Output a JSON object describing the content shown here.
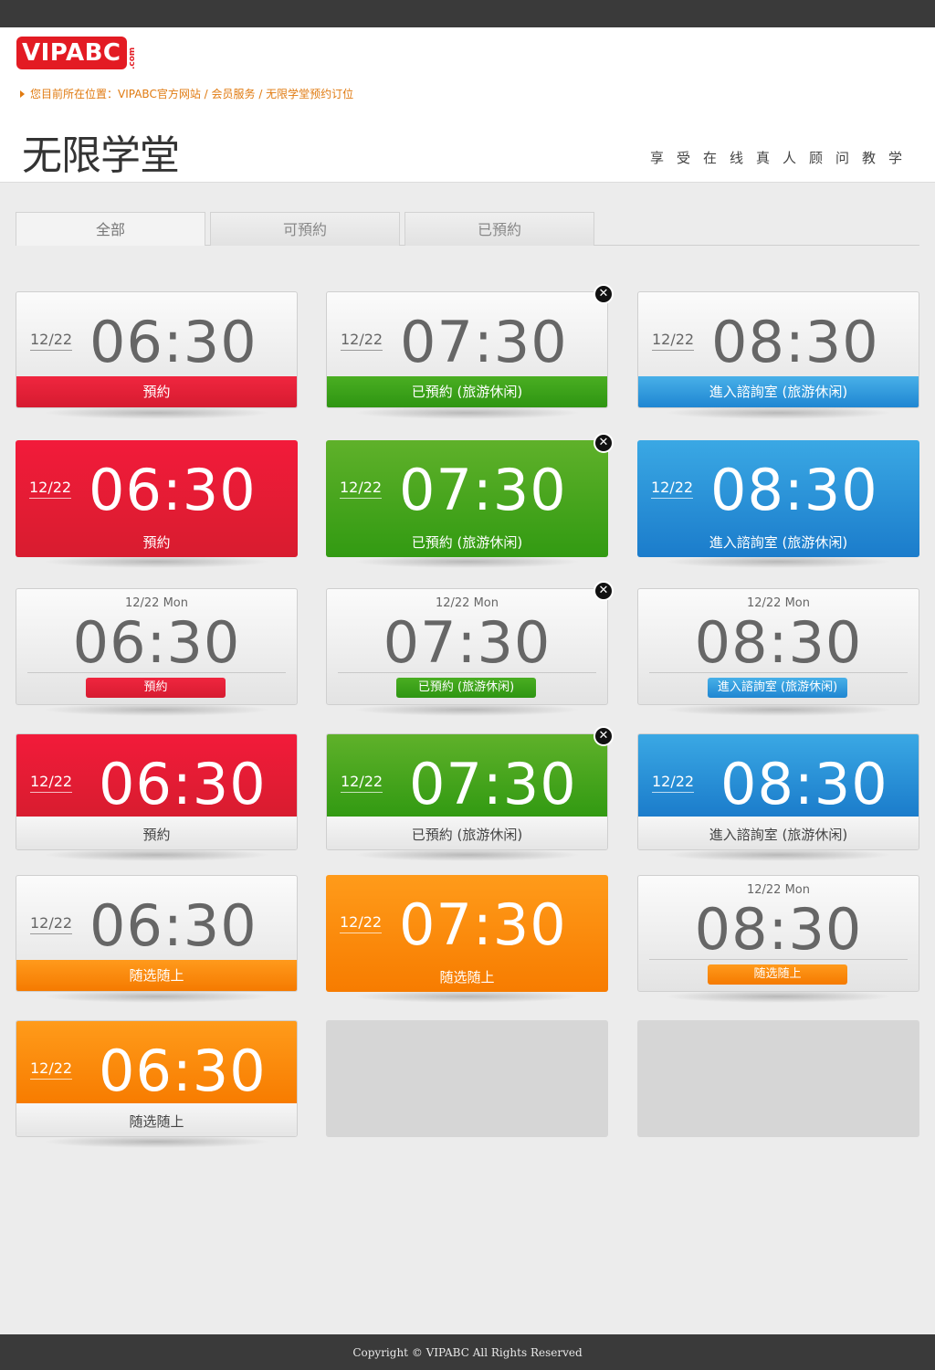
{
  "brand": {
    "logo_text": "VIPABC",
    "logo_suffix": ".com",
    "color": "#e31b23"
  },
  "breadcrumb": "您目前所在位置：VIPABC官方网站 / 会员服务 / 无限学堂预约订位",
  "page_title": "无限学堂",
  "slogan": "享受在线真人顾问教学",
  "tabs": [
    {
      "label": "全部",
      "active": true
    },
    {
      "label": "可預約",
      "active": false
    },
    {
      "label": "已預約",
      "active": false
    }
  ],
  "rows": [
    {
      "style": "strip",
      "cards": [
        {
          "date": "12/22",
          "time": "06:30",
          "label": "預約",
          "color": "red",
          "closable": false
        },
        {
          "date": "12/22",
          "time": "07:30",
          "label": "已預約 (旅游休闲)",
          "color": "green",
          "closable": true
        },
        {
          "date": "12/22",
          "time": "08:30",
          "label": "進入諮詢室 (旅游休闲)",
          "color": "blue",
          "closable": false
        }
      ]
    },
    {
      "style": "full",
      "cards": [
        {
          "date": "12/22",
          "time": "06:30",
          "label": "預約",
          "color": "red",
          "closable": false
        },
        {
          "date": "12/22",
          "time": "07:30",
          "label": "已預約 (旅游休闲)",
          "color": "green",
          "closable": true
        },
        {
          "date": "12/22",
          "time": "08:30",
          "label": "進入諮詢室 (旅游休闲)",
          "color": "blue",
          "closable": false
        }
      ]
    },
    {
      "style": "pill",
      "cards": [
        {
          "date": "12/22 Mon",
          "time": "06:30",
          "label": "預約",
          "color": "red",
          "closable": false
        },
        {
          "date": "12/22 Mon",
          "time": "07:30",
          "label": "已預約 (旅游休闲)",
          "color": "green",
          "closable": true
        },
        {
          "date": "12/22 Mon",
          "time": "08:30",
          "label": "進入諮詢室 (旅游休闲)",
          "color": "blue",
          "closable": false
        }
      ]
    },
    {
      "style": "top",
      "cards": [
        {
          "date": "12/22",
          "time": "06:30",
          "label": "預約",
          "color": "red",
          "closable": false
        },
        {
          "date": "12/22",
          "time": "07:30",
          "label": "已預約 (旅游休闲)",
          "color": "green",
          "closable": true
        },
        {
          "date": "12/22",
          "time": "08:30",
          "label": "進入諮詢室 (旅游休闲)",
          "color": "blue",
          "closable": false
        }
      ]
    },
    {
      "style": "mixed",
      "cards": [
        {
          "date": "12/22",
          "time": "06:30",
          "label": "随选随上",
          "color": "orange",
          "closable": false,
          "style": "strip"
        },
        {
          "date": "12/22",
          "time": "07:30",
          "label": "随选随上",
          "color": "orange",
          "closable": false,
          "style": "full"
        },
        {
          "date": "12/22 Mon",
          "time": "08:30",
          "label": "随选随上",
          "color": "orange",
          "closable": false,
          "style": "pill"
        }
      ]
    },
    {
      "style": "mixed",
      "cards": [
        {
          "date": "12/22",
          "time": "06:30",
          "label": "随选随上",
          "color": "orange",
          "closable": false,
          "style": "top"
        },
        {
          "placeholder": true
        },
        {
          "placeholder": true
        }
      ]
    }
  ],
  "close_icon": "close-icon",
  "footer": "Copyright © VIPABC All Rights Reserved"
}
